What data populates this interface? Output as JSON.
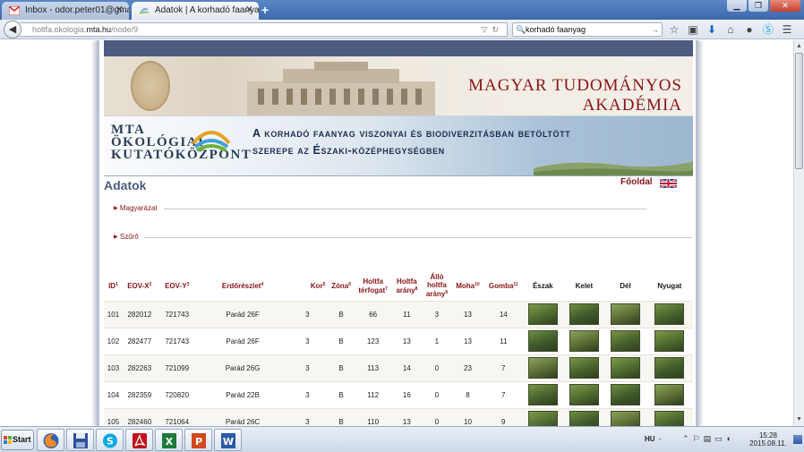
{
  "browser": {
    "tabs": [
      {
        "title": "Inbox - odor.peter01@gmail....",
        "active": false
      },
      {
        "title": "Adatok | A korhadó faanyag ...",
        "active": true
      }
    ],
    "url_prefix": "holtfa.okologia.",
    "url_domain": "mta.hu",
    "url_suffix": "/node/9",
    "search_value": "korhadó faanyag"
  },
  "banner": {
    "institute": "MAGYAR TUDOMÁNYOS AKADÉMIA",
    "logo_lines": [
      "MTA",
      "ÖKOLÓGIAI",
      "KUTATÓKÖZPONT"
    ],
    "project_line1": "A korhadó faanyag viszonyai és biodiverzitásban betöltött",
    "project_line2": "szerepe az Északi-középhegységben"
  },
  "page": {
    "heading": "Adatok",
    "home_link": "Főoldal",
    "sections": [
      "Magyarázat",
      "Szűrő"
    ]
  },
  "table": {
    "columns": [
      {
        "label": "ID",
        "sup": "1"
      },
      {
        "label": "EOV-X",
        "sup": "2"
      },
      {
        "label": "EOV-Y",
        "sup": "3"
      },
      {
        "label": "Erdőrészlet",
        "sup": "4"
      },
      {
        "label": "Kor",
        "sup": "5"
      },
      {
        "label": "Zóna",
        "sup": "6"
      },
      {
        "label": "Holtfa térfogat",
        "sup": "7"
      },
      {
        "label": "Holtfa arány",
        "sup": "8"
      },
      {
        "label": "Álló holtfa arány",
        "sup": "9"
      },
      {
        "label": "Moha",
        "sup": "10"
      },
      {
        "label": "Gomba",
        "sup": "11"
      },
      {
        "label": "Észak",
        "sup": ""
      },
      {
        "label": "Kelet",
        "sup": ""
      },
      {
        "label": "Dél",
        "sup": ""
      },
      {
        "label": "Nyugat",
        "sup": ""
      }
    ],
    "rows": [
      [
        "101",
        "282012",
        "721743",
        "Parád 26F",
        "3",
        "B",
        "66",
        "11",
        "3",
        "13",
        "14"
      ],
      [
        "102",
        "282477",
        "721743",
        "Parád 26F",
        "3",
        "B",
        "123",
        "13",
        "1",
        "13",
        "11"
      ],
      [
        "103",
        "282263",
        "721099",
        "Parád 26G",
        "3",
        "B",
        "113",
        "14",
        "0",
        "23",
        "7"
      ],
      [
        "104",
        "282359",
        "720820",
        "Parád 22B",
        "3",
        "B",
        "112",
        "16",
        "0",
        "8",
        "7"
      ],
      [
        "105",
        "282460",
        "721064",
        "Parád 26C",
        "3",
        "B",
        "110",
        "13",
        "0",
        "10",
        "9"
      ]
    ]
  },
  "taskbar": {
    "start_label": "Start",
    "language": "HU",
    "time": "15:28",
    "date": "2015.08.11."
  },
  "colors": {
    "accent_red": "#8a1418",
    "header_blue": "#4d5b80",
    "title_blue": "#1c2c52"
  }
}
